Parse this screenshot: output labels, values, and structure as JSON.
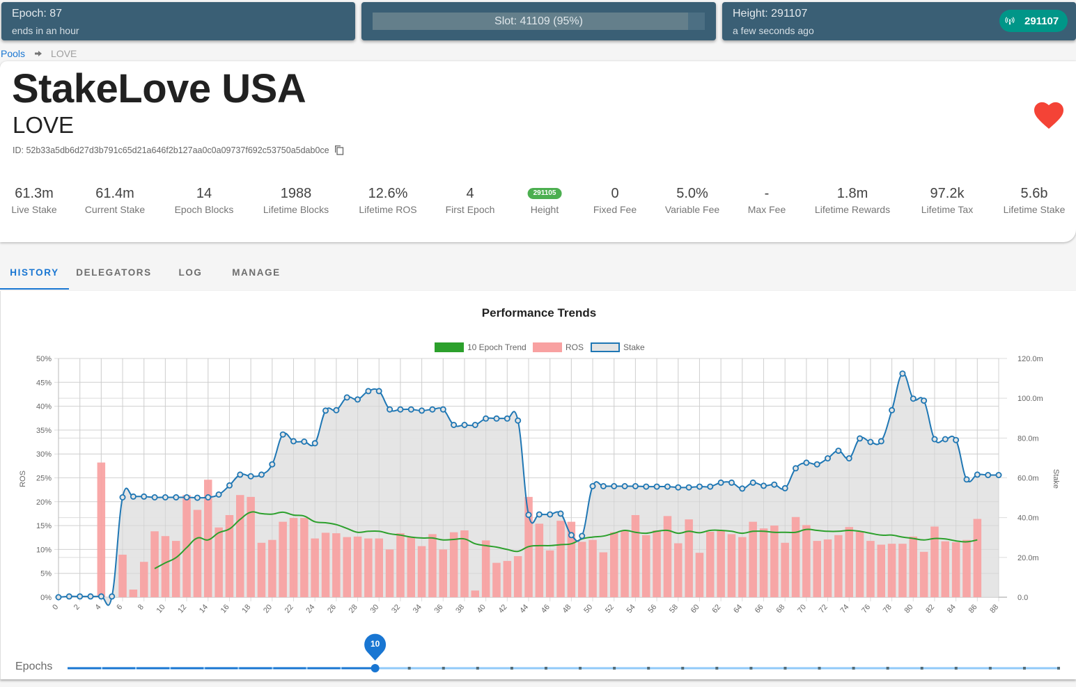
{
  "header": {
    "epoch": {
      "title": "Epoch: 87",
      "subtitle": "ends in an hour"
    },
    "slot": {
      "label": "Slot: 41109 (95%)",
      "progress_percent": 95
    },
    "height": {
      "title": "Height: 291107",
      "subtitle": "a few seconds ago",
      "chip_value": "291107",
      "chip_icon": "antenna-icon"
    }
  },
  "breadcrumb": {
    "root": "Pools",
    "separator_icon": "arrow-right-icon",
    "current": "LOVE"
  },
  "pool": {
    "name": "StakeLove USA",
    "ticker": "LOVE",
    "id_text": "ID: 52b33a5db6d27d3b791c65d21a646f2b127aa0c0a09737f692c53750a5dab0ce",
    "favorite_icon": "heart-icon",
    "favorite_color": "#f44336",
    "stats": [
      {
        "value": "61.3m",
        "label": "Live Stake"
      },
      {
        "value": "61.4m",
        "label": "Current Stake"
      },
      {
        "value": "14",
        "label": "Epoch Blocks"
      },
      {
        "value": "1988",
        "label": "Lifetime Blocks"
      },
      {
        "value": "12.6%",
        "label": "Lifetime ROS"
      },
      {
        "value": "4",
        "label": "First Epoch"
      },
      {
        "value": "291105",
        "label": "Height",
        "badge": true
      },
      {
        "value": "0",
        "label": "Fixed Fee"
      },
      {
        "value": "5.0%",
        "label": "Variable Fee"
      },
      {
        "value": "-",
        "label": "Max Fee"
      },
      {
        "value": "1.8m",
        "label": "Lifetime Rewards"
      },
      {
        "value": "97.2k",
        "label": "Lifetime Tax"
      },
      {
        "value": "5.6b",
        "label": "Lifetime Stake"
      }
    ]
  },
  "tabs": [
    {
      "label": "HISTORY",
      "active": true
    },
    {
      "label": "DELEGATORS",
      "active": false
    },
    {
      "label": "LOG",
      "active": false
    },
    {
      "label": "MANAGE",
      "active": false
    }
  ],
  "slider": {
    "label": "Epochs",
    "value": 10,
    "value_label": "10",
    "min": 1,
    "max": 30
  },
  "colors": {
    "accent": "#1976d2",
    "header_bg": "#3a5f75",
    "chip": "#009688",
    "badge": "#4caf50",
    "trend": "#2ca02c",
    "ros": "#f8a1a1",
    "stake_line": "#1f77b4",
    "stake_fill": "#e4e4e4"
  },
  "chart_data": {
    "type": "bar",
    "title": "Performance Trends",
    "legend": [
      "10 Epoch Trend",
      "ROS",
      "Stake"
    ],
    "legend_position": "top-center",
    "xlabel": "",
    "ylabel": "ROS",
    "y2label": "Stake",
    "xlim": [
      0,
      88
    ],
    "x_ticks": [
      0,
      2,
      4,
      6,
      8,
      10,
      12,
      14,
      16,
      18,
      20,
      22,
      24,
      26,
      28,
      30,
      32,
      34,
      36,
      38,
      40,
      42,
      44,
      46,
      48,
      50,
      52,
      54,
      56,
      58,
      60,
      62,
      64,
      66,
      68,
      70,
      72,
      74,
      76,
      78,
      80,
      82,
      84,
      86,
      88
    ],
    "ylim": [
      0,
      50
    ],
    "y_ticks": [
      "0%",
      "5%",
      "10%",
      "15%",
      "20%",
      "25%",
      "30%",
      "35%",
      "40%",
      "45%",
      "50%"
    ],
    "y2lim": [
      0,
      120
    ],
    "y2_ticks": [
      "0.0",
      "20.0m",
      "40.0m",
      "60.0m",
      "80.0m",
      "100.0m",
      "120.0m"
    ],
    "grid": true,
    "series": [
      {
        "name": "ROS",
        "type": "bar",
        "axis": "left",
        "unit": "%",
        "x": [
          4,
          6,
          7,
          8,
          9,
          10,
          11,
          12,
          13,
          14,
          15,
          16,
          17,
          18,
          19,
          20,
          21,
          22,
          23,
          24,
          25,
          26,
          27,
          28,
          29,
          30,
          31,
          32,
          33,
          34,
          35,
          36,
          37,
          38,
          39,
          40,
          41,
          42,
          43,
          44,
          45,
          46,
          47,
          48,
          49,
          50,
          51,
          52,
          53,
          54,
          55,
          56,
          57,
          58,
          59,
          60,
          61,
          62,
          63,
          64,
          65,
          66,
          67,
          68,
          69,
          70,
          71,
          72,
          73,
          74,
          75,
          76,
          77,
          78,
          79,
          80,
          81,
          82,
          83,
          84,
          85,
          86
        ],
        "values": [
          28.2,
          8.9,
          1.6,
          7.4,
          13.8,
          12.8,
          11.8,
          21.4,
          18.3,
          24.6,
          14.6,
          17.2,
          21.4,
          21.0,
          11.4,
          12.0,
          15.8,
          16.6,
          16.6,
          12.3,
          13.5,
          13.4,
          12.6,
          12.7,
          12.3,
          12.3,
          10.0,
          13.4,
          12.6,
          10.7,
          13.2,
          10.0,
          13.6,
          14.0,
          1.4,
          11.9,
          7.2,
          7.6,
          8.6,
          21.0,
          15.4,
          9.8,
          16.0,
          15.8,
          11.6,
          12.0,
          9.4,
          13.6,
          14.0,
          17.2,
          13.0,
          14.0,
          17.0,
          11.3,
          16.3,
          9.3,
          13.7,
          14.0,
          13.2,
          12.6,
          15.8,
          14.4,
          15.0,
          11.4,
          16.8,
          15.1,
          11.8,
          12.1,
          13.0,
          14.7,
          13.7,
          11.8,
          11.0,
          11.2,
          11.2,
          12.7,
          9.5,
          14.8,
          11.7,
          11.5,
          12.0,
          16.4
        ]
      },
      {
        "name": "10 Epoch Trend",
        "type": "line",
        "axis": "left",
        "unit": "%",
        "x": [
          9,
          10,
          11,
          12,
          13,
          14,
          15,
          16,
          17,
          18,
          19,
          20,
          21,
          22,
          23,
          24,
          25,
          26,
          27,
          28,
          29,
          30,
          31,
          32,
          33,
          34,
          35,
          36,
          37,
          38,
          39,
          40,
          41,
          42,
          43,
          44,
          45,
          46,
          47,
          48,
          49,
          50,
          51,
          52,
          53,
          54,
          55,
          56,
          57,
          58,
          59,
          60,
          61,
          62,
          63,
          64,
          65,
          66,
          67,
          68,
          69,
          70,
          71,
          72,
          73,
          74,
          75,
          76,
          77,
          78,
          79,
          80,
          81,
          82,
          83,
          84,
          85,
          86
        ],
        "values": [
          6.0,
          7.2,
          8.3,
          10.4,
          12.4,
          12.0,
          13.5,
          14.3,
          16.3,
          17.8,
          17.5,
          17.4,
          17.8,
          17.2,
          17.0,
          15.8,
          15.6,
          15.2,
          14.4,
          13.6,
          13.8,
          13.8,
          13.3,
          13.0,
          12.6,
          12.4,
          12.4,
          12.0,
          12.1,
          12.2,
          11.2,
          10.8,
          10.5,
          10.0,
          9.6,
          10.6,
          10.8,
          10.8,
          11.0,
          11.2,
          12.2,
          12.6,
          12.8,
          13.4,
          14.0,
          13.6,
          13.4,
          13.8,
          14.0,
          13.4,
          13.8,
          13.5,
          14.0,
          14.0,
          13.8,
          13.4,
          13.8,
          13.8,
          13.6,
          13.6,
          13.6,
          14.2,
          14.0,
          13.8,
          13.8,
          14.0,
          13.8,
          13.4,
          13.0,
          13.0,
          12.6,
          12.3,
          12.0,
          12.3,
          12.2,
          11.8,
          11.6,
          12.0
        ]
      },
      {
        "name": "Stake",
        "type": "area",
        "axis": "right",
        "unit": "m",
        "x": [
          0,
          1,
          2,
          3,
          4,
          5,
          6,
          7,
          8,
          9,
          10,
          11,
          12,
          13,
          14,
          15,
          16,
          17,
          18,
          19,
          20,
          21,
          22,
          23,
          24,
          25,
          26,
          27,
          28,
          29,
          30,
          31,
          32,
          33,
          34,
          35,
          36,
          37,
          38,
          39,
          40,
          41,
          42,
          43,
          44,
          45,
          46,
          47,
          48,
          49,
          50,
          51,
          52,
          53,
          54,
          55,
          56,
          57,
          58,
          59,
          60,
          61,
          62,
          63,
          64,
          65,
          66,
          67,
          68,
          69,
          70,
          71,
          72,
          73,
          74,
          75,
          76,
          77,
          78,
          79,
          80,
          81,
          82,
          83,
          84,
          85,
          86,
          87,
          88
        ],
        "values": [
          0,
          0.4,
          0.4,
          0.4,
          0.4,
          0.4,
          50.2,
          50.6,
          50.6,
          50.2,
          50.2,
          50.2,
          50.2,
          50.0,
          50.2,
          51.6,
          56.2,
          61.6,
          60.8,
          61.6,
          66.8,
          81.8,
          78.4,
          78.2,
          77.4,
          93.8,
          94.0,
          100.4,
          99.4,
          103.6,
          103.6,
          94.4,
          94.4,
          94.4,
          93.8,
          94.4,
          94.4,
          86.6,
          86.6,
          86.6,
          89.8,
          89.8,
          89.8,
          88.8,
          41.4,
          41.6,
          41.6,
          42.0,
          31.2,
          30.8,
          55.8,
          55.8,
          55.8,
          55.8,
          55.8,
          55.6,
          55.6,
          55.6,
          55.2,
          55.2,
          55.6,
          55.6,
          57.6,
          57.6,
          54.6,
          57.6,
          56.0,
          56.6,
          54.8,
          64.8,
          67.6,
          66.8,
          69.8,
          73.6,
          69.8,
          79.8,
          78.0,
          78.4,
          94.0,
          112.4,
          99.8,
          98.8,
          79.4,
          79.4,
          79.0,
          59.2,
          61.6,
          61.4,
          61.4
        ]
      }
    ]
  }
}
